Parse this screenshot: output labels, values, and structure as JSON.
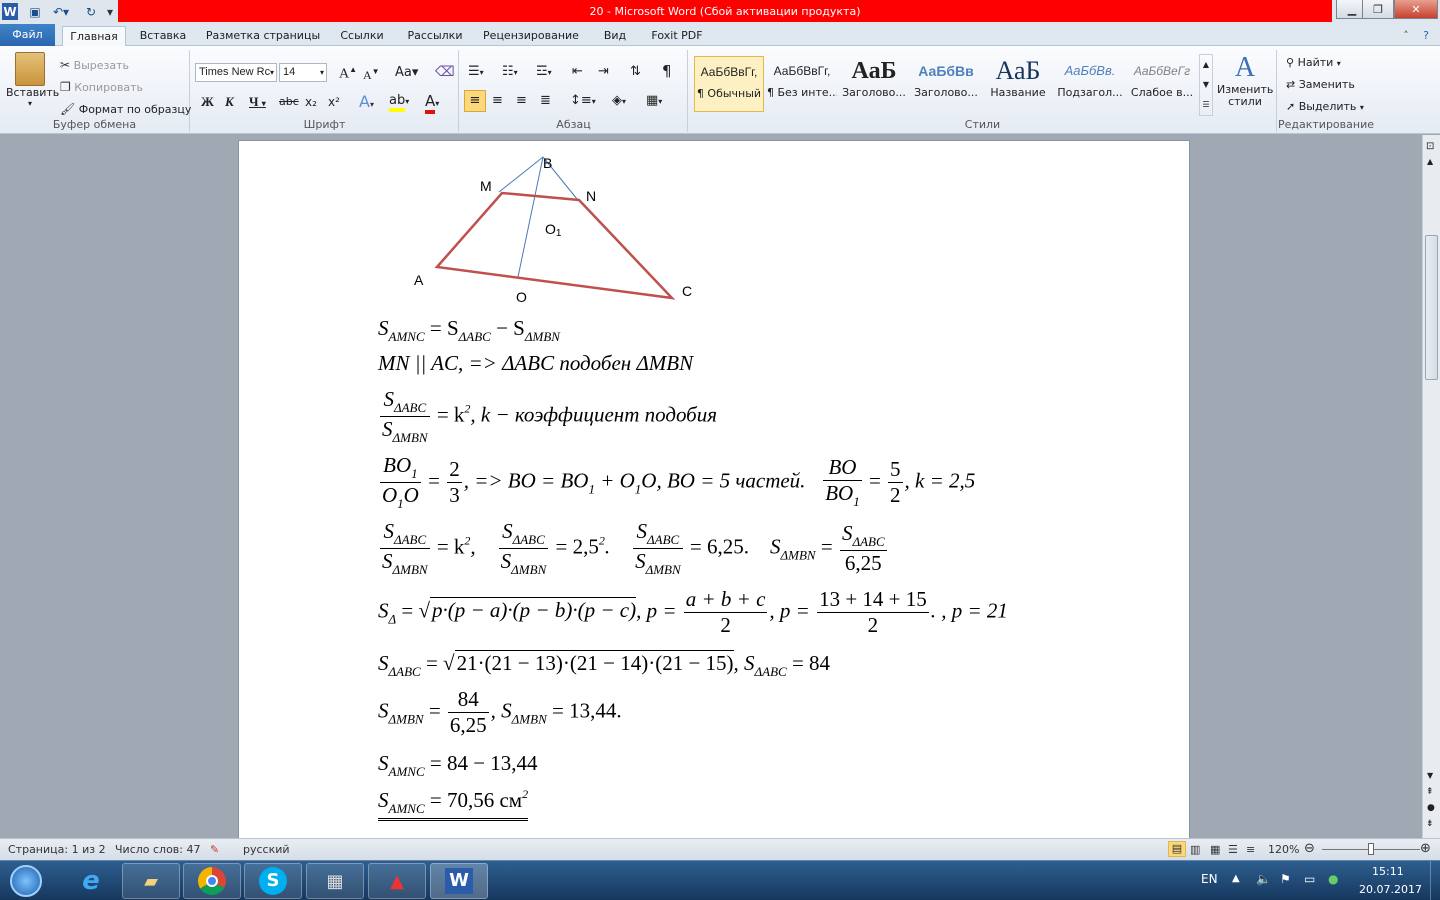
{
  "window": {
    "title": "20  -  Microsoft Word (Сбой активации продукта)",
    "app_icon": "W"
  },
  "tabs": [
    "Файл",
    "Главная",
    "Вставка",
    "Разметка страницы",
    "Ссылки",
    "Рассылки",
    "Рецензирование",
    "Вид",
    "Foxit PDF"
  ],
  "clipboard": {
    "paste": "Вставить",
    "cut": "Вырезать",
    "copy": "Копировать",
    "format_painter": "Формат по образцу",
    "label": "Буфер обмена"
  },
  "font": {
    "name": "Times New Rc",
    "size": "14",
    "label": "Шрифт",
    "case": "Aa",
    "grow": "A",
    "shrink": "A",
    "bold": "Ж",
    "italic": "К",
    "underline": "Ч",
    "strike": "abc",
    "subscript": "x₂",
    "superscript": "x²"
  },
  "paragraph": {
    "label": "Абзац",
    "pilcrow": "¶"
  },
  "styles": {
    "label": "Стили",
    "items": [
      {
        "preview": "АаБбВвГг,",
        "name": "¶ Обычный"
      },
      {
        "preview": "АаБбВвГг,",
        "name": "¶ Без инте..."
      },
      {
        "preview": "АаБ",
        "name": "Заголово..."
      },
      {
        "preview": "АаБбВв",
        "name": "Заголово..."
      },
      {
        "preview": "АаБ",
        "name": "Название"
      },
      {
        "preview": "АаБбВв.",
        "name": "Подзагол..."
      },
      {
        "preview": "АаБбВеГг",
        "name": "Слабое в..."
      }
    ],
    "change_styles": "Изменить стили"
  },
  "editing": {
    "label": "Редактирование",
    "find": "Найти",
    "replace": "Заменить",
    "select": "Выделить"
  },
  "figure": {
    "B": "B",
    "M": "M",
    "N": "N",
    "O1": "O",
    "O1_sub": "1",
    "A": "A",
    "O": "O",
    "C": "C"
  },
  "equations": {
    "l1": {
      "a": "S",
      "a_sub": "AMNC",
      "b": " = S",
      "b_sub": "ΔABC",
      "c": " − S",
      "c_sub": "ΔMBN"
    },
    "l2": "MN || AC,    =>    ΔABC  подобен ΔMBN",
    "l3": {
      "num": "S",
      "num_sub": "ΔABC",
      "den": "S",
      "den_sub": "ΔMBN",
      "rest": " = k",
      "sup": "2",
      "tail": ",    k − коэффициент подобия"
    },
    "l4": {
      "n1": "BO",
      "n1_sub": "1",
      "d1": "O",
      "d1_sub": "1",
      "d1_tail": "O",
      "eq1": " = ",
      "fn": "2",
      "fd": "3",
      "mid": ",    => BO = BO",
      "mid_sub": "1",
      "mid2": " + O",
      "mid2_sub": "1",
      "mid3": "O,    BO = 5 частей.",
      "n2": "BO",
      "d2": "BO",
      "d2_sub": "1",
      "fn2": "5",
      "fd2": "2",
      "tail": ",    k  = 2,5"
    },
    "l5": {
      "a": " = k",
      "a_sup": "2",
      "b": " = 2,5",
      "b_sup": "2",
      "b_tail": ".",
      "c": " = 6,25.",
      "d": "S",
      "d_sub": "ΔMBN",
      "d_eq": " = ",
      "num": "S",
      "num_sub": "ΔABC",
      "den": "S",
      "den_sub": "ΔMBN",
      "den2": "6,25"
    },
    "l6": {
      "a": "S",
      "a_sub": "Δ",
      "b": " = ",
      "rad": "p·(p − a)·(p − b)·(p − c)",
      "c": ",    p = ",
      "fn": "a + b + c",
      "fd": "2",
      "d": ",    p = ",
      "fn2": "13 + 14 + 15",
      "fd2": "2",
      "e": ".    ,    p = 21"
    },
    "l7": {
      "a": "S",
      "a_sub": "ΔABC",
      "b": " = ",
      "rad": "21·(21 − 13)·(21 − 14)·(21 − 15)",
      "c": ",    S",
      "c_sub": "ΔABC",
      "d": " = 84"
    },
    "l8": {
      "a": "S",
      "a_sub": "ΔMBN",
      "b": " = ",
      "fn": "84",
      "fd": "6,25",
      "c": ",    S",
      "c_sub": "ΔMBN",
      "d": " = 13,44."
    },
    "l9": {
      "a": "S",
      "a_sub": "AMNC",
      "b": " = 84 − 13,44"
    },
    "l10": {
      "a": "S",
      "a_sub": "AMNC",
      "b": " = 70,56 см",
      "sup": "2"
    }
  },
  "status": {
    "page": "Страница: 1 из 2",
    "words": "Число слов: 47",
    "lang": "русский",
    "zoom": "120%"
  },
  "taskbar": {
    "lang": "EN",
    "time": "15:11",
    "date": "20.07.2017"
  }
}
